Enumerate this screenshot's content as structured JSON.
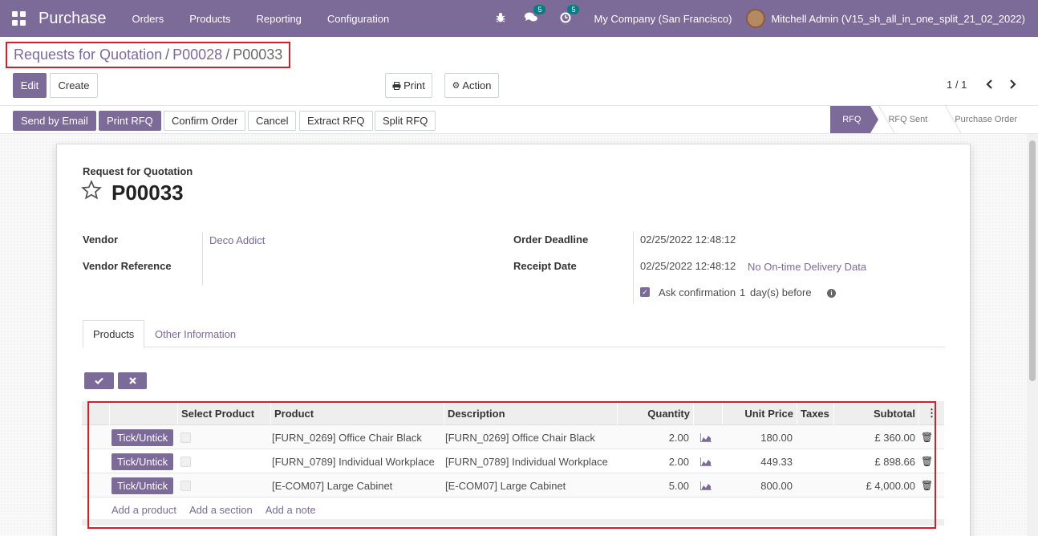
{
  "navbar": {
    "brand": "Purchase",
    "menu": [
      "Orders",
      "Products",
      "Reporting",
      "Configuration"
    ],
    "chat_badge": "5",
    "activity_badge": "5",
    "company": "My Company (San Francisco)",
    "user": "Mitchell Admin (V15_sh_all_in_one_split_21_02_2022)"
  },
  "breadcrumb": {
    "items": [
      "Requests for Quotation",
      "P00028"
    ],
    "current": "P00033",
    "separator": "/"
  },
  "toolbar": {
    "edit": "Edit",
    "create": "Create",
    "print": "Print",
    "action": "Action",
    "pager": "1 / 1"
  },
  "statusbar": {
    "buttons": [
      "Send by Email",
      "Print RFQ",
      "Confirm Order",
      "Cancel",
      "Extract RFQ",
      "Split RFQ"
    ],
    "stages": [
      "RFQ",
      "RFQ Sent",
      "Purchase Order"
    ],
    "active_stage": "RFQ"
  },
  "form": {
    "subtitle": "Request for Quotation",
    "name": "P00033",
    "vendor_label": "Vendor",
    "vendor_value": "Deco Addict",
    "vendor_ref_label": "Vendor Reference",
    "vendor_ref_value": "",
    "order_deadline_label": "Order Deadline",
    "order_deadline_value": "02/25/2022 12:48:12",
    "receipt_date_label": "Receipt Date",
    "receipt_date_value": "02/25/2022 12:48:12",
    "on_time_link": "No On-time Delivery Data",
    "ask_confirmation_prefix": "Ask confirmation",
    "ask_confirmation_days": "1",
    "ask_confirmation_suffix": "day(s) before"
  },
  "tabs": [
    "Products",
    "Other Information"
  ],
  "lines": {
    "columns": {
      "select_product": "Select Product",
      "product": "Product",
      "description": "Description",
      "quantity": "Quantity",
      "unit_price": "Unit Price",
      "taxes": "Taxes",
      "subtotal": "Subtotal"
    },
    "tick_label": "Tick/Untick",
    "rows": [
      {
        "product": "[FURN_0269] Office Chair Black",
        "description": "[FURN_0269] Office Chair Black",
        "quantity": "2.00",
        "unit_price": "180.00",
        "taxes": "",
        "subtotal": "£ 360.00"
      },
      {
        "product": "[FURN_0789] Individual Workplace",
        "description": "[FURN_0789] Individual Workplace",
        "quantity": "2.00",
        "unit_price": "449.33",
        "taxes": "",
        "subtotal": "£ 898.66"
      },
      {
        "product": "[E-COM07] Large Cabinet",
        "description": "[E-COM07] Large Cabinet",
        "quantity": "5.00",
        "unit_price": "800.00",
        "taxes": "",
        "subtotal": "£ 4,000.00"
      }
    ],
    "add_links": [
      "Add a product",
      "Add a section",
      "Add a note"
    ]
  },
  "colors": {
    "brand": "#7c6a98",
    "highlight_border": "#d0202b"
  }
}
